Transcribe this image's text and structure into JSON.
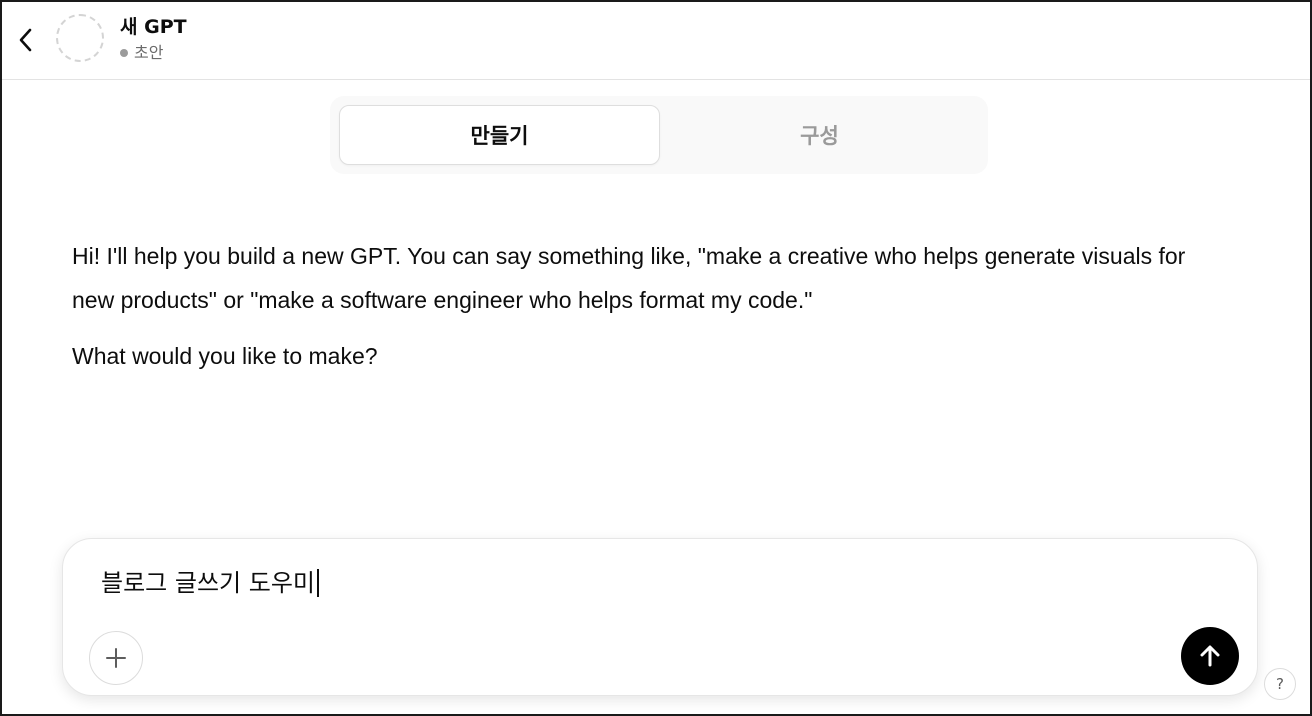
{
  "header": {
    "title": "새 GPT",
    "status": "초안",
    "back_icon": "chevron-left-icon"
  },
  "tabs": [
    {
      "label": "만들기",
      "active": true
    },
    {
      "label": "구성",
      "active": false
    }
  ],
  "message": {
    "paragraph1": "Hi! I'll help you build a new GPT. You can say something like, \"make a creative who helps generate visuals for new products\" or \"make a software engineer who helps format my code.\"",
    "paragraph2": "What would you like to make?"
  },
  "composer": {
    "value": "블로그 글쓰기 도우미",
    "attach_icon": "plus-icon",
    "send_icon": "arrow-up-icon"
  },
  "help": {
    "label": "?"
  },
  "colors": {
    "send_button": "#000000",
    "inactive_tab": "#9a9a9a",
    "status_dot": "#9b9b9b"
  }
}
